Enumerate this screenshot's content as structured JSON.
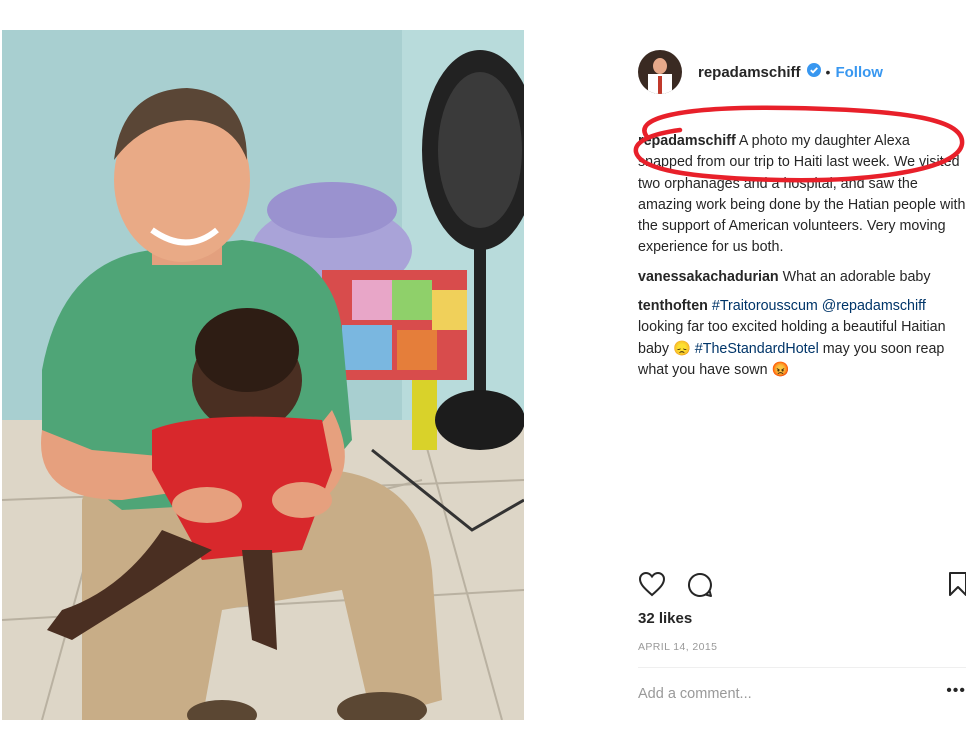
{
  "post": {
    "username": "repadamschiff",
    "follow_label": "Follow",
    "separator": "•",
    "caption": {
      "username": "repadamschiff",
      "text": "A photo my daughter Alexa snapped from our trip to Haiti last week. We visited two orphanages and a hospital, and saw the amazing work being done by the Hatian people with the support of American volunteers. Very moving experience for us both."
    },
    "comments": [
      {
        "username": "vanessakachadurian",
        "text": "What an adorable baby"
      },
      {
        "username": "tenthoften",
        "hashtag1": "#Traitorousscum",
        "mention": "@repadamschiff",
        "text_mid": "looking far too excited holding a beautiful Haitian baby 😞",
        "hashtag2": "#TheStandardHotel",
        "text_end": "may you soon reap what you have sown 😡"
      }
    ],
    "likes": "32 likes",
    "date": "APRIL 14, 2015",
    "add_comment_placeholder": "Add a comment...",
    "more_label": "•••"
  },
  "icons": [
    "verified-badge-icon",
    "heart-icon",
    "comment-icon",
    "bookmark-icon",
    "more-icon"
  ],
  "colors": {
    "link": "#3897f0",
    "hashtag": "#003569",
    "annotation": "#e8202a",
    "muted": "#999999"
  }
}
